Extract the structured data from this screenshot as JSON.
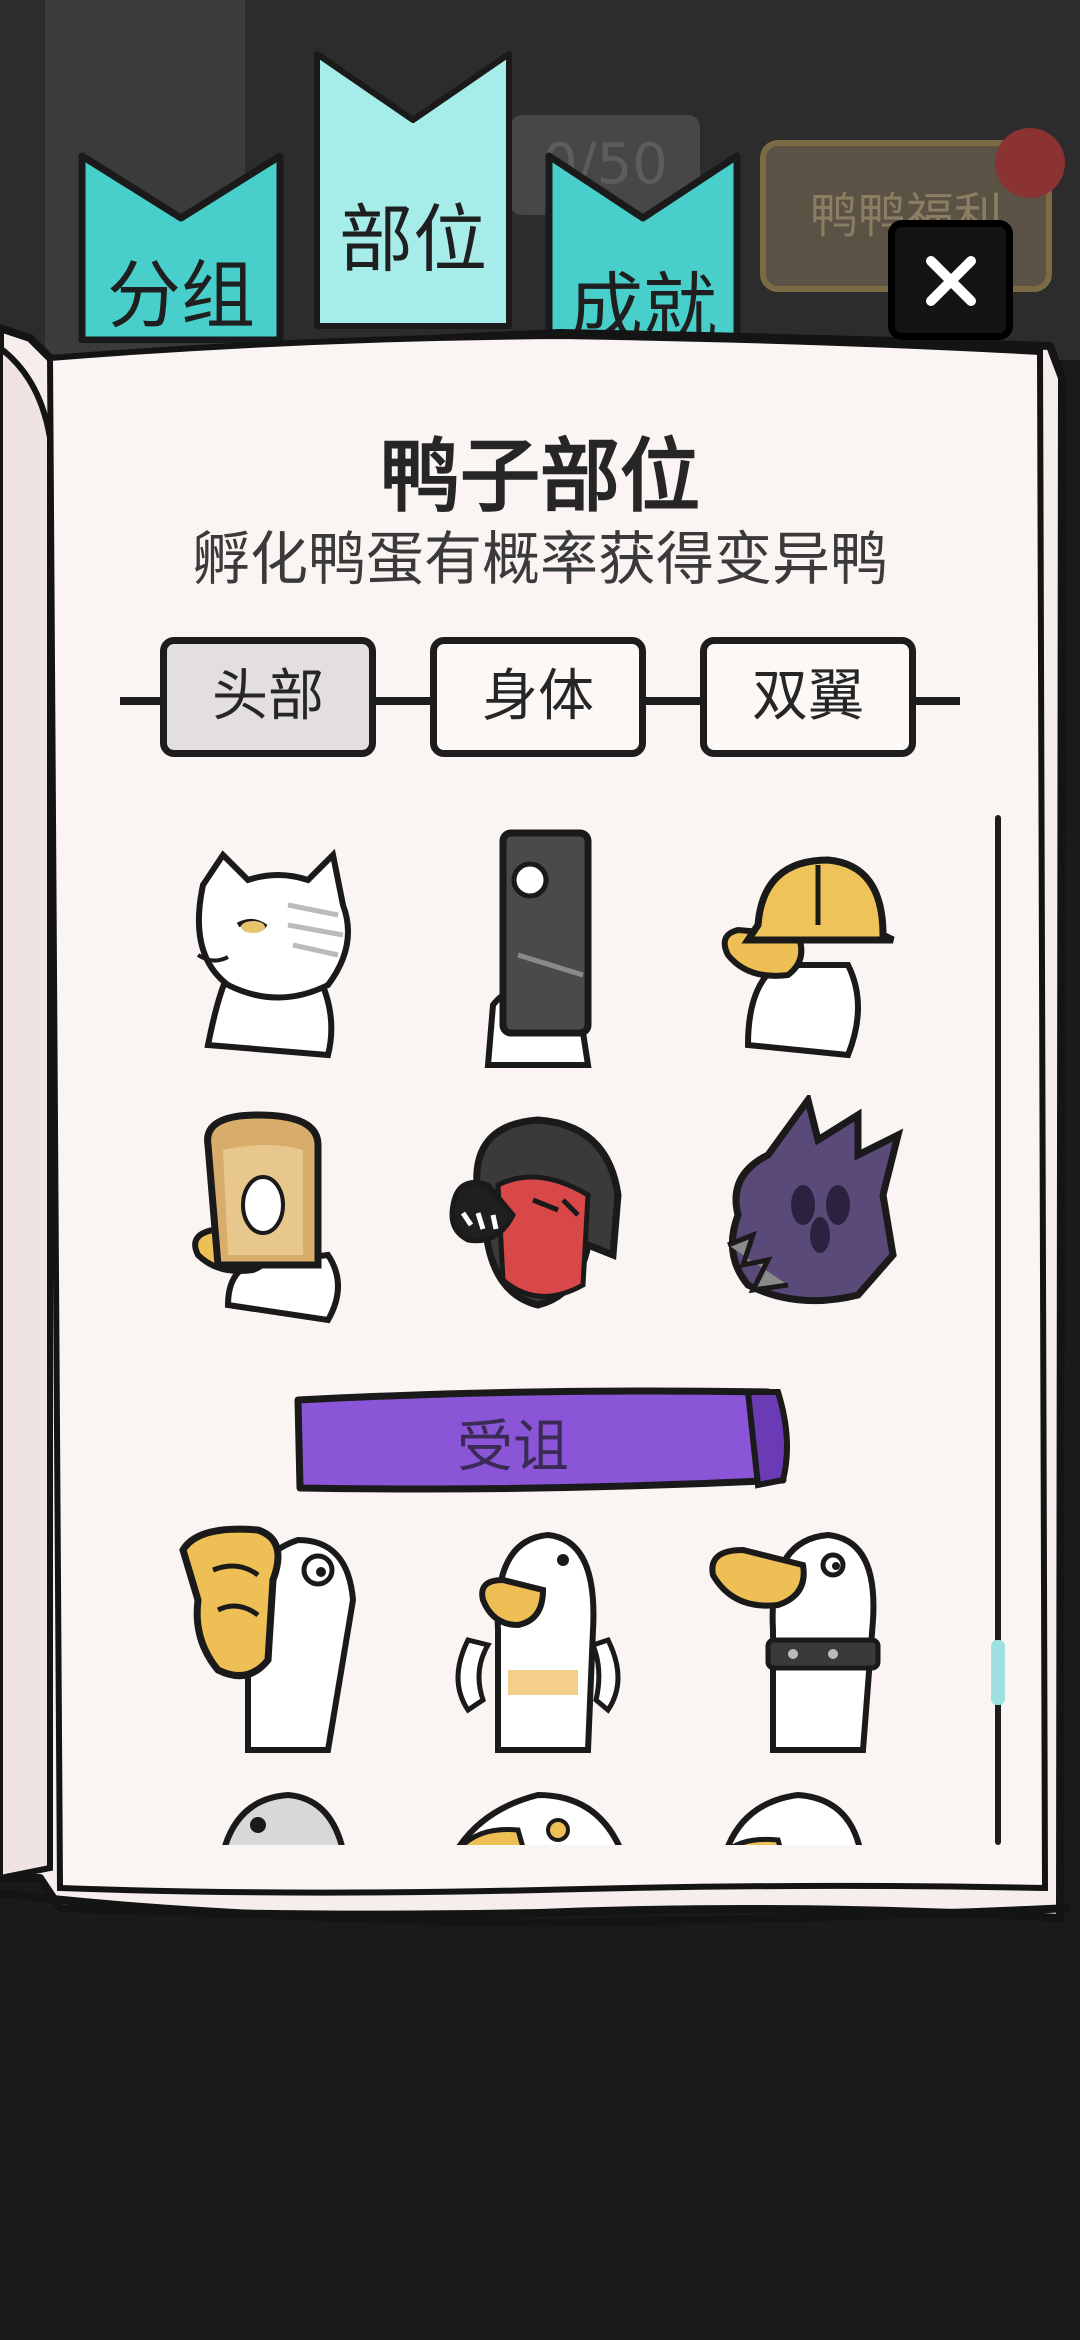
{
  "background": {
    "counter_text": "0/50",
    "bonus_label": "鸭鸭福利"
  },
  "tabs": [
    {
      "label": "分组"
    },
    {
      "label": "部位"
    },
    {
      "label": "成就"
    }
  ],
  "panel": {
    "title": "鸭子部位",
    "subtitle": "孵化鸭蛋有概率获得变异鸭"
  },
  "segments": [
    {
      "label": "头部",
      "active": true
    },
    {
      "label": "身体",
      "active": false
    },
    {
      "label": "双翼",
      "active": false
    }
  ],
  "parts_grid": [
    {
      "icon": "cat-head-icon"
    },
    {
      "icon": "phone-head-icon"
    },
    {
      "icon": "hardhat-duck-icon"
    },
    {
      "icon": "toast-duck-icon"
    },
    {
      "icon": "red-demon-head-icon"
    },
    {
      "icon": "purple-spiked-helmet-icon"
    }
  ],
  "section_banner": {
    "label": "受诅",
    "color": "#8a55d6"
  },
  "cursed_grid": [
    {
      "icon": "cursed-mask-duck-icon"
    },
    {
      "icon": "white-duck-icon"
    },
    {
      "icon": "collared-duck-icon"
    },
    {
      "icon": "duck-head-icon"
    },
    {
      "icon": "duck-head-icon"
    },
    {
      "icon": "duck-head-icon"
    }
  ],
  "colors": {
    "tab_teal": "#49cfcb",
    "tab_active": "#a6ece8",
    "paper": "#faf5f3",
    "banner_purple": "#8a55d6"
  }
}
